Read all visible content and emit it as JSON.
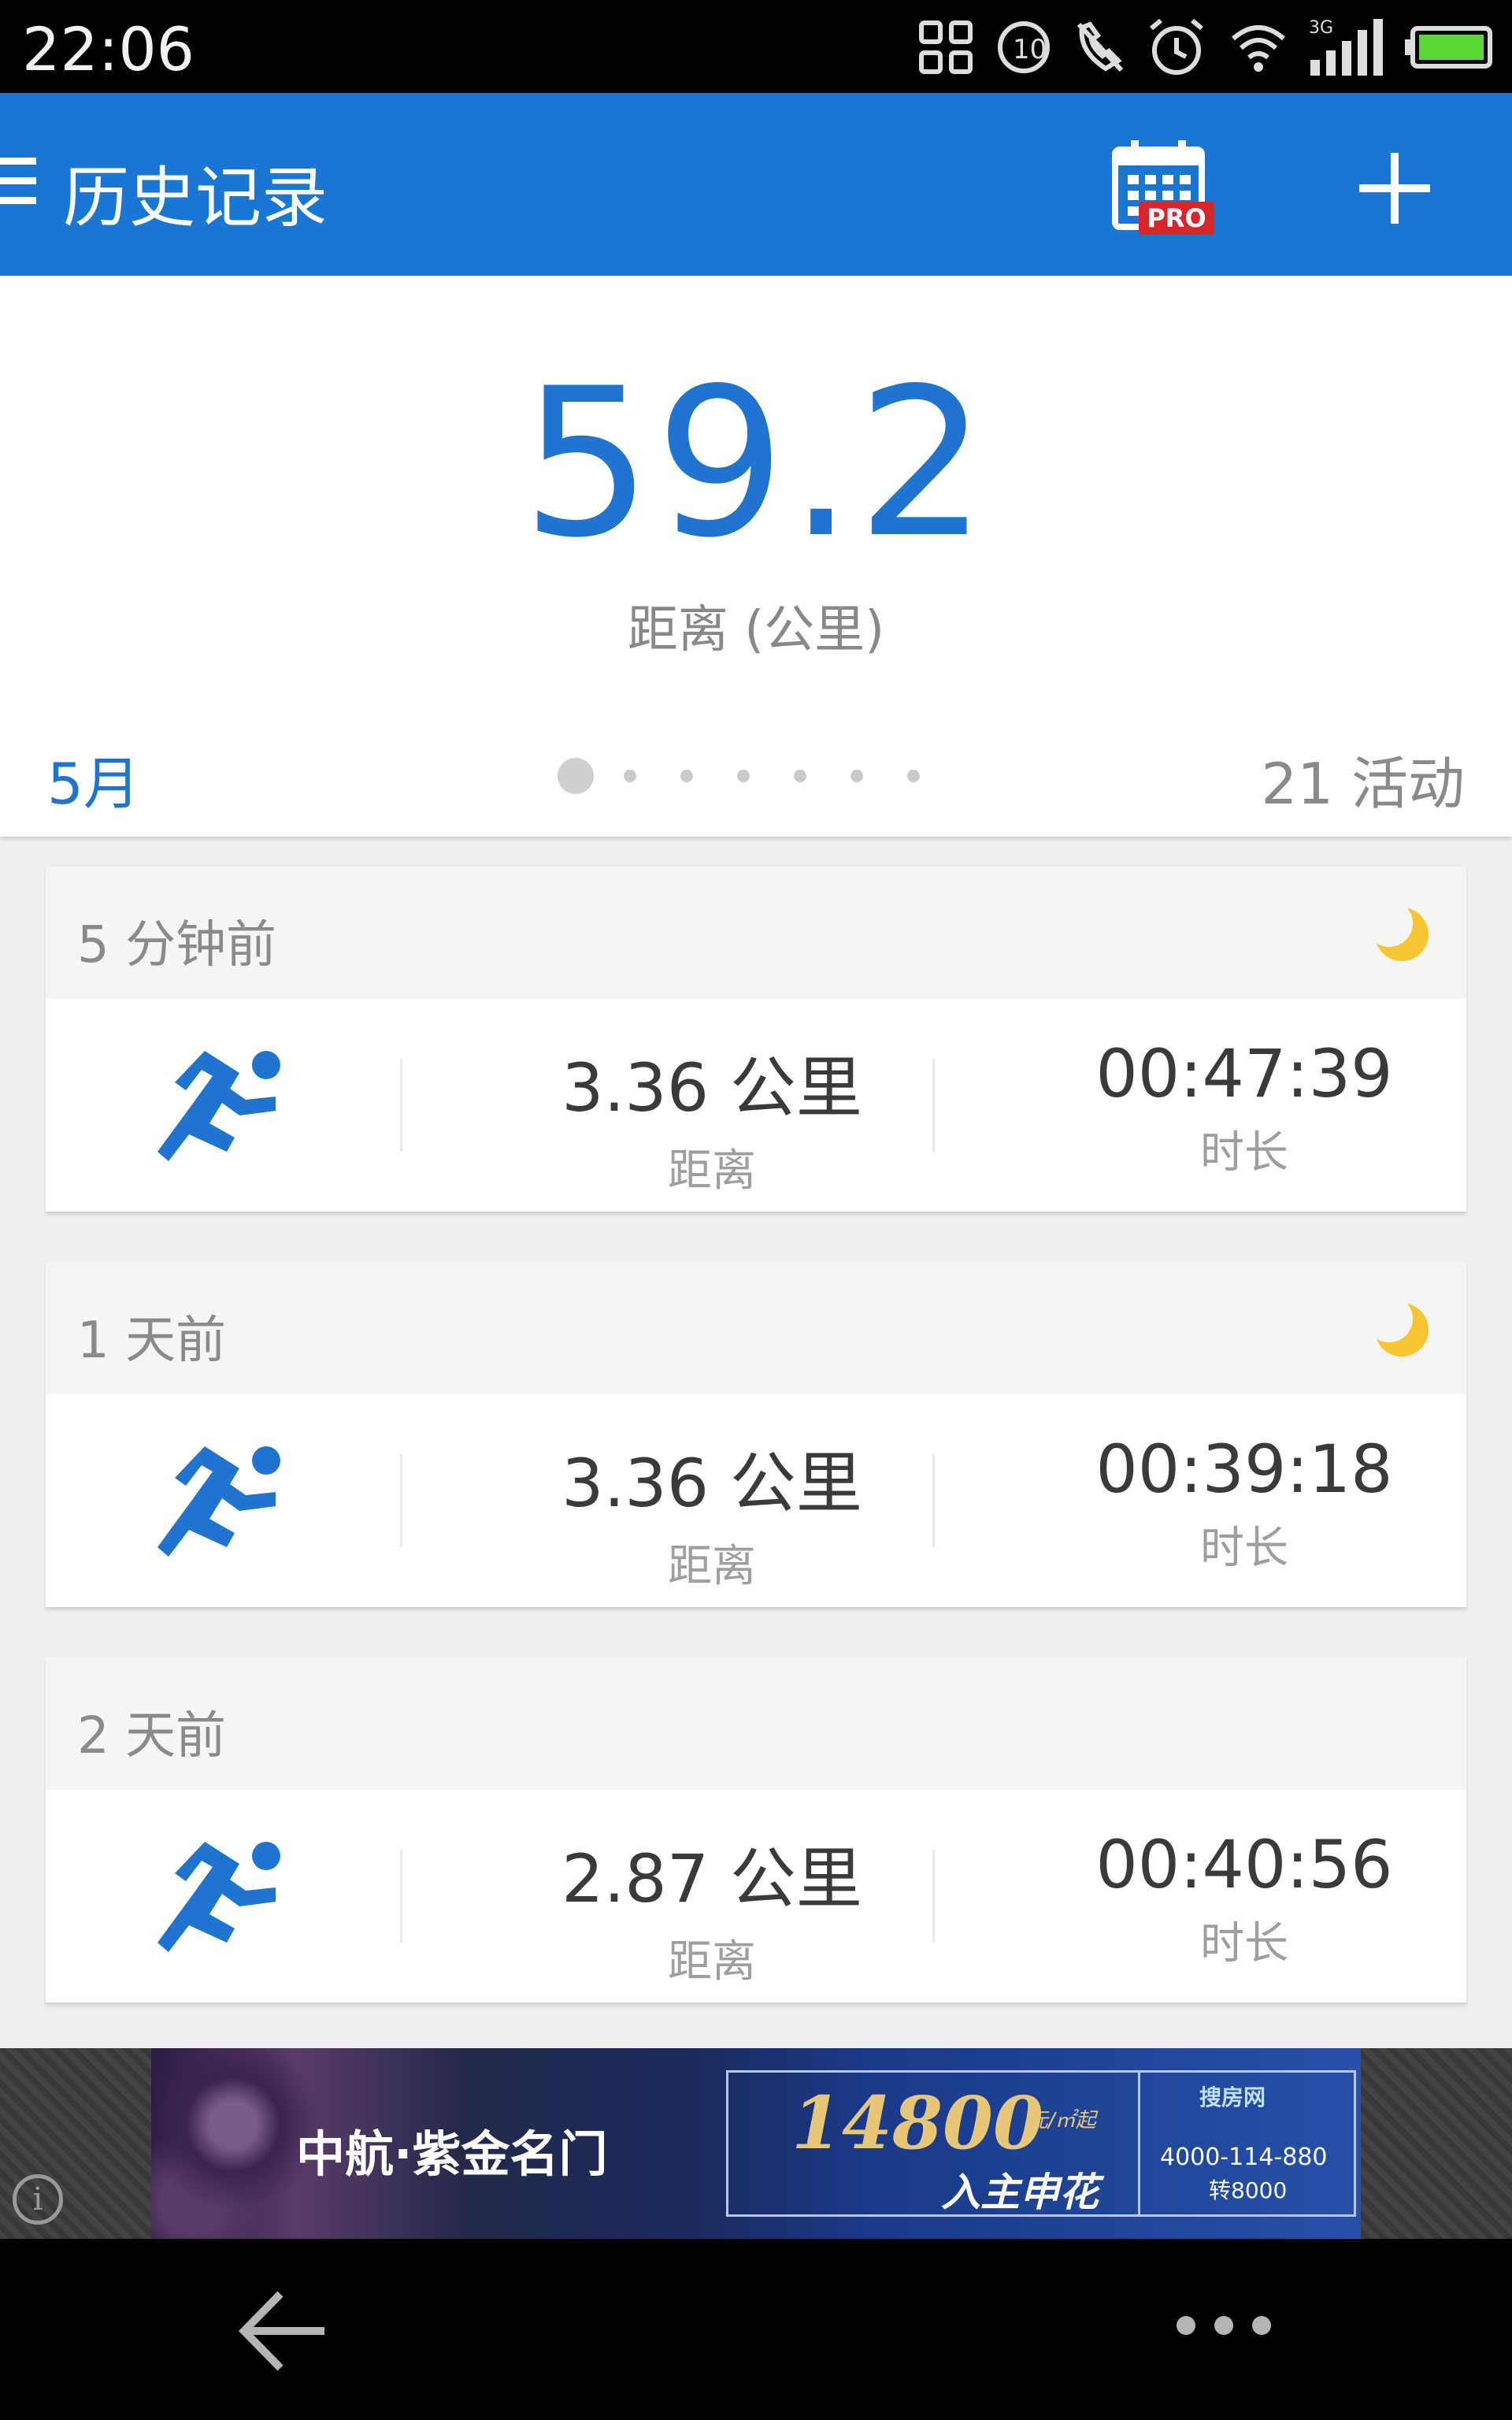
{
  "status_bar": {
    "time": "22:06",
    "icons": [
      "qr-scan-icon",
      "timer-icon",
      "no-phone-icon",
      "alarm-icon",
      "wifi-icon",
      "signal-3g-icon",
      "battery-icon"
    ],
    "network_label": "3G",
    "timer_badge": "10"
  },
  "app_bar": {
    "title": "历史记录",
    "pro_badge": "PRO",
    "background": "#1976d2"
  },
  "summary": {
    "total_distance": "59.2",
    "distance_label": "距离 (公里)",
    "month": "5月",
    "activities": "21 活动",
    "page_count": 7,
    "active_page": 1,
    "accent": "#1f74cf"
  },
  "activities": [
    {
      "time_ago": "5 分钟前",
      "night": true,
      "icon": "running-icon",
      "distance": "3.36 公里",
      "distance_label": "距离",
      "duration": "00:47:39",
      "duration_label": "时长"
    },
    {
      "time_ago": "1 天前",
      "night": true,
      "icon": "running-icon",
      "distance": "3.36 公里",
      "distance_label": "距离",
      "duration": "00:39:18",
      "duration_label": "时长"
    },
    {
      "time_ago": "2 天前",
      "night": false,
      "icon": "running-icon",
      "distance": "2.87 公里",
      "distance_label": "距离",
      "duration": "00:40:56",
      "duration_label": "时长"
    }
  ],
  "ad": {
    "brand": "中航·紫金名门",
    "price": "14800",
    "price_unit": "元/㎡起",
    "slogan": "入主申花",
    "phone": "4000-114-880",
    "extension": "转8000",
    "logo_text": "搜房网",
    "info_glyph": "i"
  },
  "nav": {
    "back_icon": "back-arrow-icon",
    "more_icon": "more-dots-icon"
  }
}
